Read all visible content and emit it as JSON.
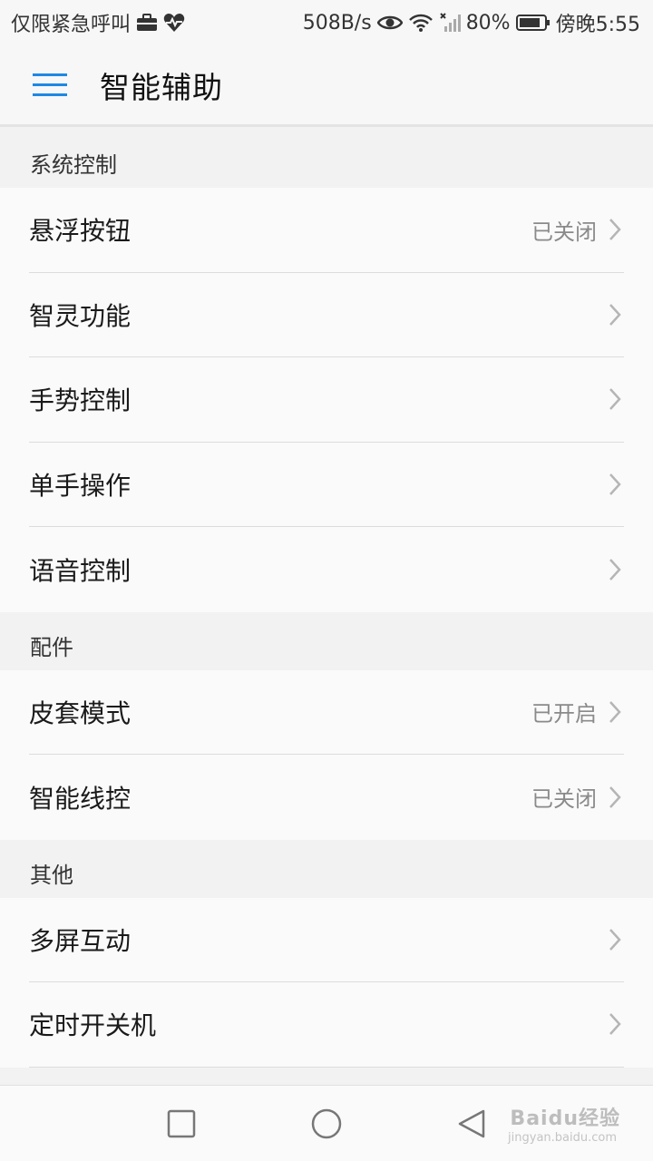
{
  "status_bar": {
    "carrier_text": "仅限紧急呼叫",
    "net_speed": "508B/s",
    "battery_percent": "80%",
    "time": "傍晚5:55",
    "icons": [
      "briefcase-icon",
      "heartbeat-icon",
      "eye-icon",
      "wifi-icon",
      "signal-icon",
      "battery-icon"
    ]
  },
  "app_bar": {
    "title": "智能辅助",
    "menu_icon": "hamburger-menu-icon"
  },
  "sections": [
    {
      "header": "系统控制",
      "items": [
        {
          "label": "悬浮按钮",
          "value": "已关闭"
        },
        {
          "label": "智灵功能",
          "value": ""
        },
        {
          "label": "手势控制",
          "value": ""
        },
        {
          "label": "单手操作",
          "value": ""
        },
        {
          "label": "语音控制",
          "value": ""
        }
      ]
    },
    {
      "header": "配件",
      "items": [
        {
          "label": "皮套模式",
          "value": "已开启"
        },
        {
          "label": "智能线控",
          "value": "已关闭"
        }
      ]
    },
    {
      "header": "其他",
      "items": [
        {
          "label": "多屏互动",
          "value": ""
        },
        {
          "label": "定时开关机",
          "value": ""
        }
      ]
    }
  ],
  "nav_bar": {
    "icons": [
      "recent-apps-icon",
      "home-icon",
      "back-icon"
    ],
    "watermark": "Baidu经验",
    "watermark_sub": "jingyan.baidu.com"
  },
  "colors": {
    "accent": "#1e88e5",
    "background": "#f2f2f2",
    "list_background": "#fafafa",
    "secondary_text": "#8a8a8a"
  }
}
